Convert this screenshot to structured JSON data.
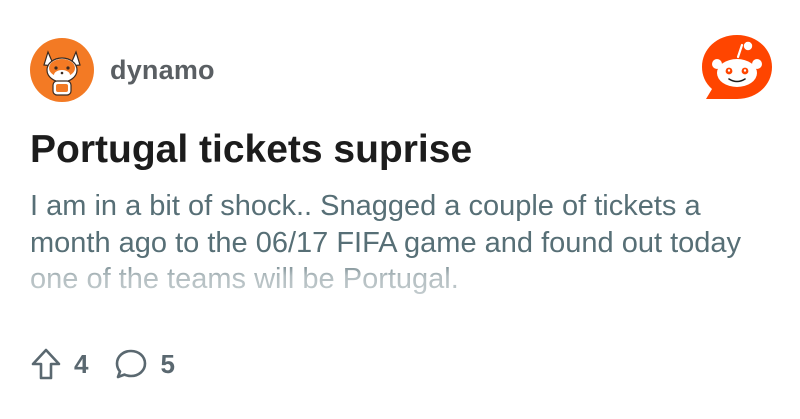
{
  "post": {
    "author": "dynamo",
    "title": "Portugal tickets suprise",
    "body": "I am in a bit of shock.. Snagged a couple of tickets a month ago to the 06/17 FIFA game and found out today one of the teams will be Portugal."
  },
  "actions": {
    "upvotes": "4",
    "comments": "5"
  },
  "icons": {
    "avatar": "fox-avatar-icon",
    "logo": "reddit-logo-icon",
    "upvote": "upvote-arrow-icon",
    "comment": "comment-bubble-icon"
  },
  "colors": {
    "brand": "#ff4500",
    "avatar_bg": "#f37a24",
    "text": "#1c1c1c",
    "muted": "#576f76"
  }
}
